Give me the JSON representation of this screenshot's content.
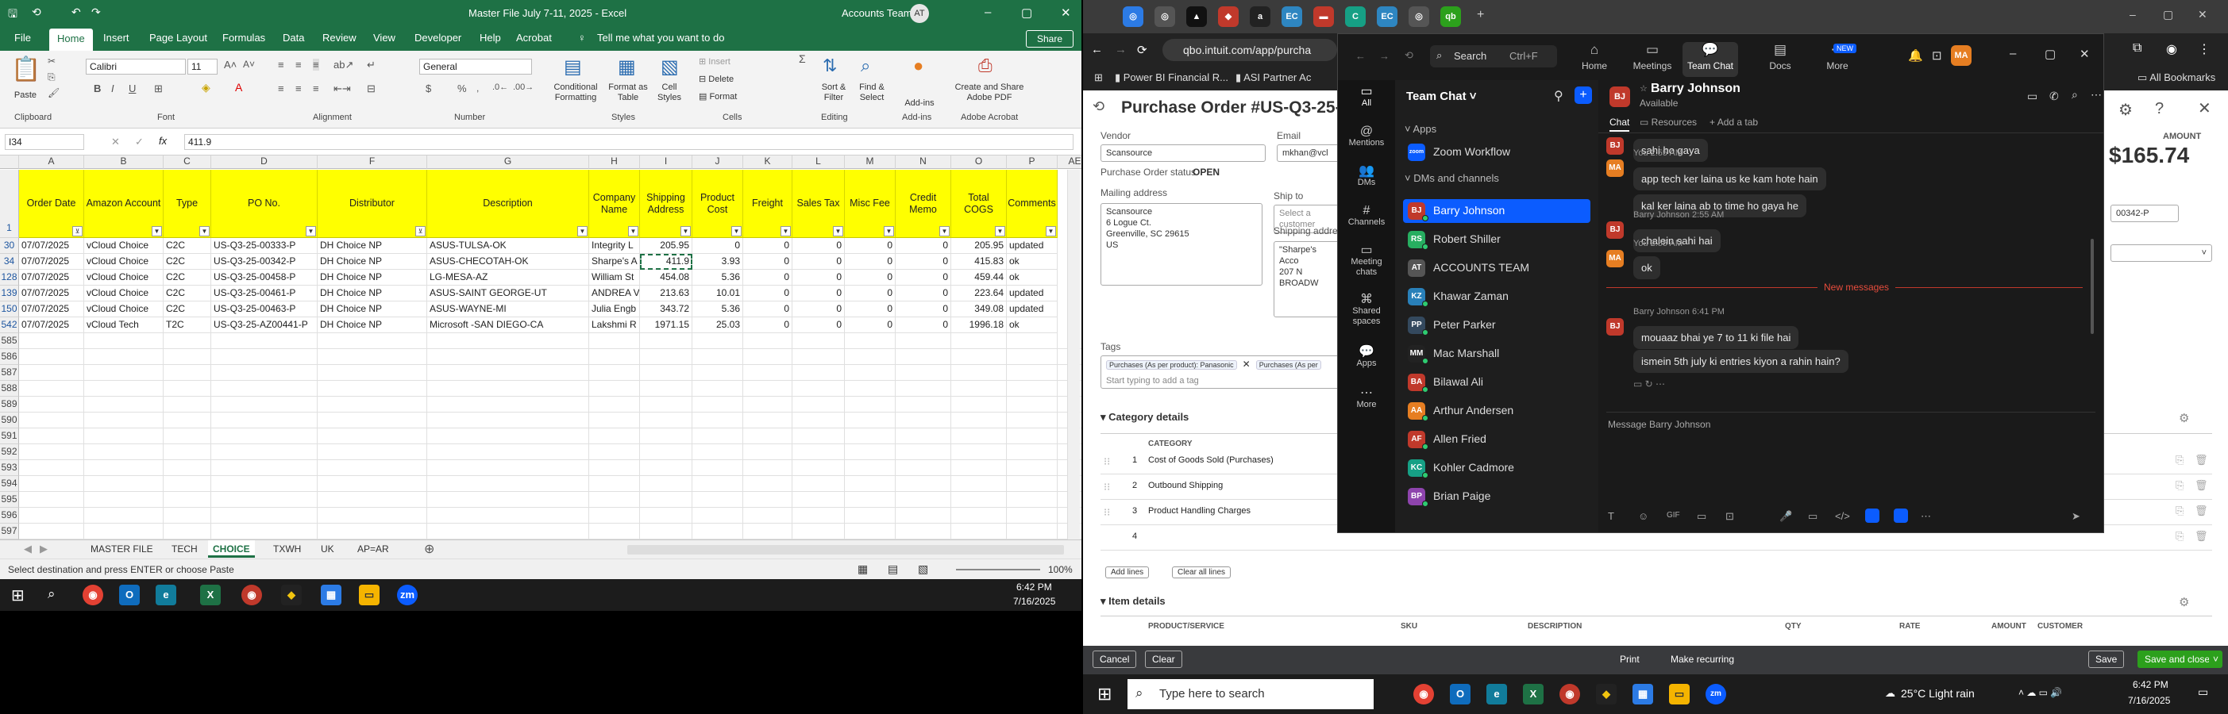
{
  "excel": {
    "title": "Master File July 7-11, 2025 - Excel",
    "account": "Accounts Team",
    "avatar": "AT",
    "tabs": [
      "File",
      "Home",
      "Insert",
      "Page Layout",
      "Formulas",
      "Data",
      "Review",
      "Developer",
      "Help",
      "Acrobat"
    ],
    "tell_me": "Tell me what you want to do",
    "share": "Share",
    "ribbon": {
      "paste": "Paste",
      "font_name": "Calibri",
      "font_size": "11",
      "number_format": "General",
      "insert": "Insert",
      "delete": "Delete",
      "format": "Format",
      "conditional_formatting": "Conditional Formatting",
      "format_as_table": "Format as Table",
      "cell_styles": "Cell Styles",
      "sort_filter": "Sort & Filter",
      "find_select": "Find & Select",
      "addins": "Add-ins",
      "create_pdf": "Create and Share Adobe PDF",
      "groups": [
        "Clipboard",
        "Font",
        "Alignment",
        "Number",
        "Styles",
        "Cells",
        "Editing",
        "Add-ins",
        "Adobe Acrobat"
      ]
    },
    "name_box": "I34",
    "formula": "411.9",
    "columns": [
      "A",
      "B",
      "C",
      "D",
      "F",
      "G",
      "H",
      "I",
      "J",
      "K",
      "L",
      "M",
      "N",
      "O",
      "P",
      "AE"
    ],
    "headers": [
      "Order Date",
      "Amazon Account",
      "Type",
      "PO No.",
      "Distributor",
      "Description",
      "Company Name",
      "Shipping Address",
      "Product Cost",
      "Freight",
      "Sales Tax",
      "Misc Fee",
      "Credit Memo",
      "Total COGS",
      "Comments"
    ],
    "header_row": "1",
    "rows": [
      {
        "n": "30",
        "c": [
          "07/07/2025",
          "vCloud Choice",
          "C2C",
          "US-Q3-25-00333-P",
          "DH Choice NP",
          "ASUS-TULSA-OK",
          "Integrity L",
          "205.95",
          "0",
          "0",
          "0",
          "0",
          "0",
          "205.95",
          "updated"
        ]
      },
      {
        "n": "34",
        "c": [
          "07/07/2025",
          "vCloud Choice",
          "C2C",
          "US-Q3-25-00342-P",
          "DH Choice NP",
          "ASUS-CHECOTAH-OK",
          "Sharpe's A",
          "411.9",
          "3.93",
          "0",
          "0",
          "0",
          "0",
          "415.83",
          "ok"
        ]
      },
      {
        "n": "128",
        "c": [
          "07/07/2025",
          "vCloud Choice",
          "C2C",
          "US-Q3-25-00458-P",
          "DH Choice NP",
          "LG-MESA-AZ",
          "William St",
          "454.08",
          "5.36",
          "0",
          "0",
          "0",
          "0",
          "459.44",
          "ok"
        ]
      },
      {
        "n": "139",
        "c": [
          "07/07/2025",
          "vCloud Choice",
          "C2C",
          "US-Q3-25-00461-P",
          "DH Choice NP",
          "ASUS-SAINT GEORGE-UT",
          "ANDREA V",
          "213.63",
          "10.01",
          "0",
          "0",
          "0",
          "0",
          "223.64",
          "updated"
        ]
      },
      {
        "n": "150",
        "c": [
          "07/07/2025",
          "vCloud Choice",
          "C2C",
          "US-Q3-25-00463-P",
          "DH Choice NP",
          "ASUS-WAYNE-MI",
          "Julia Engb",
          "343.72",
          "5.36",
          "0",
          "0",
          "0",
          "0",
          "349.08",
          "updated"
        ]
      },
      {
        "n": "542",
        "c": [
          "07/07/2025",
          "vCloud Tech",
          "T2C",
          "US-Q3-25-AZ00441-P",
          "DH Choice NP",
          "Microsoft -SAN DIEGO-CA",
          "Lakshmi R",
          "1971.15",
          "25.03",
          "0",
          "0",
          "0",
          "0",
          "1996.18",
          "ok"
        ]
      }
    ],
    "empty_rows": [
      "585",
      "586",
      "587",
      "588",
      "589",
      "590",
      "591",
      "592",
      "593",
      "594",
      "595",
      "596",
      "597"
    ],
    "sheets": [
      "MASTER FILE",
      "TECH",
      "CHOICE",
      "TXWH",
      "UK",
      "AP=AR"
    ],
    "active_sheet": "CHOICE",
    "status": "Select destination and press ENTER or choose Paste",
    "zoom": "100%",
    "time": "6:42 PM",
    "date": "7/16/2025"
  },
  "browser": {
    "url": "qbo.intuit.com/app/purcha",
    "bookmarks": [
      "Power BI Financial R...",
      "ASI Partner Ac"
    ],
    "all_bookmarks": "All Bookmarks"
  },
  "qbo": {
    "title": "Purchase Order #US-Q3-25-003",
    "vendor_label": "Vendor",
    "vendor": "Scansource",
    "email_label": "Email",
    "email": "mkhan@vcl",
    "status_label": "Purchase Order status",
    "status": "OPEN",
    "mailing_label": "Mailing address",
    "mailing": [
      "Scansource",
      "6 Logue Ct.",
      "Greenville, SC 29615",
      "US"
    ],
    "shipto_label": "Ship to",
    "shipto_placeholder": "Select a customer",
    "shipping_label": "Shipping address",
    "shipping": [
      "\"Sharpe's Acco",
      "207 N BROADW"
    ],
    "amount_label": "AMOUNT",
    "amount": "$165.74",
    "po_ref": "00342-P",
    "tags_label": "Tags",
    "tag1": "Purchases (As per product): Panasonic",
    "tag2": "Purchases (As per",
    "tags_placeholder": "Start typing to add a tag",
    "category_label": "Category details",
    "category_col": "CATEGORY",
    "categories": [
      "Cost of Goods Sold (Purchases)",
      "Outbound Shipping",
      "Product Handling Charges",
      ""
    ],
    "add_lines": "Add lines",
    "clear_lines": "Clear all lines",
    "item_label": "Item details",
    "item_cols": [
      "PRODUCT/SERVICE",
      "SKU",
      "DESCRIPTION",
      "QTY",
      "RATE",
      "AMOUNT",
      "CUSTOMER"
    ],
    "cancel": "Cancel",
    "clear": "Clear",
    "print": "Print",
    "recurring": "Make recurring",
    "save": "Save",
    "save_close": "Save and close"
  },
  "zoom": {
    "search": "Search",
    "search_shortcut": "Ctrl+F",
    "nav": [
      "Home",
      "Meetings",
      "Team Chat",
      "Docs",
      "More"
    ],
    "new_badge": "NEW",
    "avatar": "MA",
    "left_nav": [
      "All",
      "Mentions",
      "DMs",
      "Channels",
      "Meeting chats",
      "Shared spaces",
      "Apps",
      "More"
    ],
    "list_title": "Team Chat",
    "apps_label": "Apps",
    "zoom_workflow": "Zoom Workflow",
    "dms_label": "DMs and channels",
    "contacts": [
      {
        "i": "BJ",
        "n": "Barry Johnson",
        "c": "#c0392b"
      },
      {
        "i": "RS",
        "n": "Robert Shiller",
        "c": "#27ae60"
      },
      {
        "i": "AT",
        "n": "ACCOUNTS TEAM",
        "c": "#555"
      },
      {
        "i": "KZ",
        "n": "Khawar Zaman",
        "c": "#2980b9"
      },
      {
        "i": "PP",
        "n": "Peter Parker",
        "c": "#34495e"
      },
      {
        "i": "MM",
        "n": "Mac Marshall",
        "c": "#222"
      },
      {
        "i": "BA",
        "n": "Bilawal Ali",
        "c": "#c0392b"
      },
      {
        "i": "AA",
        "n": "Arthur Andersen",
        "c": "#e67e22"
      },
      {
        "i": "AF",
        "n": "Allen Fried",
        "c": "#c0392b"
      },
      {
        "i": "KC",
        "n": "Kohler Cadmore",
        "c": "#16a085"
      },
      {
        "i": "BP",
        "n": "Brian Paige",
        "c": "#8e44ad"
      }
    ],
    "chat_name": "Barry Johnson",
    "chat_status": "Available",
    "chat_tabs": [
      "Chat",
      "Resources",
      "Add a tab"
    ],
    "messages": [
      {
        "who": "BJ",
        "meta": "",
        "text": "sahi ho gaya"
      },
      {
        "who": "MA",
        "meta": "You 2:55 AM",
        "text": "app tech ker laina us ke kam hote hain"
      },
      {
        "who": "",
        "meta": "",
        "text": "kal ker laina ab to time ho gaya he"
      },
      {
        "who": "BJ",
        "meta": "Barry Johnson 2:55 AM",
        "text": "chalein sahi hai"
      },
      {
        "who": "MA",
        "meta": "You 2:55 AM",
        "text": "ok"
      },
      {
        "who": "BJ",
        "meta": "Barry Johnson 6:41 PM",
        "text": "mouaaz bhai ye 7 to 11 ki file hai"
      },
      {
        "who": "",
        "meta": "",
        "text": "ismein 5th july ki entries kiyon a rahin hain?"
      }
    ],
    "new_messages": "New messages",
    "composer": "Message Barry Johnson"
  },
  "taskbar": {
    "search": "Type here to search",
    "weather": "25°C  Light rain",
    "time": "6:42 PM",
    "date": "7/16/2025"
  }
}
